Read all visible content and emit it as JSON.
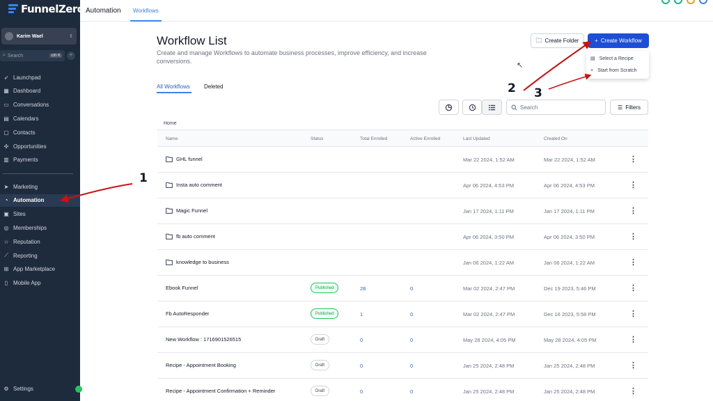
{
  "brand": {
    "name": "FunnelZero"
  },
  "account": {
    "name": "Karim Wael"
  },
  "sidebar": {
    "search_placeholder": "Search",
    "search_shortcut": "ctrl K",
    "items_top": [
      {
        "label": "Launchpad",
        "icon": "launchpad-icon"
      },
      {
        "label": "Dashboard",
        "icon": "dashboard-icon"
      },
      {
        "label": "Conversations",
        "icon": "chat-icon"
      },
      {
        "label": "Calendars",
        "icon": "calendar-icon"
      },
      {
        "label": "Contacts",
        "icon": "contacts-icon"
      },
      {
        "label": "Opportunities",
        "icon": "opportunities-icon"
      },
      {
        "label": "Payments",
        "icon": "payments-icon"
      }
    ],
    "items_bottom": [
      {
        "label": "Marketing",
        "icon": "send-icon"
      },
      {
        "label": "Automation",
        "icon": "automation-icon"
      },
      {
        "label": "Sites",
        "icon": "sites-icon"
      },
      {
        "label": "Memberships",
        "icon": "memberships-icon"
      },
      {
        "label": "Reputation",
        "icon": "star-icon"
      },
      {
        "label": "Reporting",
        "icon": "chart-icon"
      },
      {
        "label": "App Marketplace",
        "icon": "grid-icon"
      },
      {
        "label": "Mobile App",
        "icon": "mobile-icon"
      }
    ],
    "settings_label": "Settings"
  },
  "topbar": {
    "title": "Automation",
    "tab": "Workflows"
  },
  "page": {
    "title": "Workflow List",
    "description": "Create and manage Workflows to automate business processes, improve efficiency, and increase conversions.",
    "create_folder": "Create Folder",
    "create_workflow": "Create Workflow",
    "dropdown": [
      "Select a Recipe",
      "Start from Scratch"
    ],
    "tabs": [
      "All Workflows",
      "Deleted"
    ],
    "search_placeholder": "Search",
    "filters": "Filters",
    "breadcrumb": "Home"
  },
  "table": {
    "headers": [
      "Name",
      "Status",
      "Total Enrolled",
      "Active Enrolled",
      "Last Updated",
      "Created On"
    ],
    "rows": [
      {
        "name": "GHL funnel",
        "folder": true,
        "status": "",
        "total": "",
        "active": "",
        "updated": "Mar 22 2024, 1:52 AM",
        "created": "Mar 22 2024, 1:52 AM"
      },
      {
        "name": "Insta auto comment",
        "folder": true,
        "status": "",
        "total": "",
        "active": "",
        "updated": "Apr 06 2024, 4:53 PM",
        "created": "Apr 06 2024, 4:53 PM"
      },
      {
        "name": "Magic Funnel",
        "folder": true,
        "status": "",
        "total": "",
        "active": "",
        "updated": "Jan 17 2024, 1:11 PM",
        "created": "Jan 17 2024, 1:11 PM"
      },
      {
        "name": "fb auto comment",
        "folder": true,
        "status": "",
        "total": "",
        "active": "",
        "updated": "Apr 06 2024, 3:50 PM",
        "created": "Apr 06 2024, 3:50 PM"
      },
      {
        "name": "knowledge to business",
        "folder": true,
        "status": "",
        "total": "",
        "active": "",
        "updated": "Jan 06 2024, 1:22 AM",
        "created": "Jan 06 2024, 1:22 AM"
      },
      {
        "name": "Ebook Funnel",
        "folder": false,
        "status": "Published",
        "total": "28",
        "active": "0",
        "updated": "Mar 02 2024, 2:47 PM",
        "created": "Dec 19 2023, 5:46 PM"
      },
      {
        "name": "Fb AutoResponder",
        "folder": false,
        "status": "Published",
        "total": "1",
        "active": "0",
        "updated": "Mar 02 2024, 2:47 PM",
        "created": "Dec 16 2023, 5:58 PM"
      },
      {
        "name": "New Workflow : 1716901526515",
        "folder": false,
        "status": "Draft",
        "total": "0",
        "active": "0",
        "updated": "May 28 2024, 4:05 PM",
        "created": "May 28 2024, 4:05 PM"
      },
      {
        "name": "Recipe - Appointment Booking",
        "folder": false,
        "status": "Draft",
        "total": "0",
        "active": "0",
        "updated": "Jan 25 2024, 2:48 PM",
        "created": "Jan 25 2024, 2:48 PM"
      },
      {
        "name": "Recipe - Appointment Confirmation + Reminder",
        "folder": false,
        "status": "Draft",
        "total": "0",
        "active": "0",
        "updated": "Jan 25 2024, 2:48 PM",
        "created": "Jan 25 2024, 2:48 PM"
      }
    ]
  },
  "annotations": {
    "one": "1",
    "two": "2",
    "three": "3"
  },
  "colors": {
    "sidebar_bg": "#1e2b3d",
    "primary": "#1d4ed8",
    "annotation_arrow": "#cc1111",
    "published": "#16a34a"
  }
}
